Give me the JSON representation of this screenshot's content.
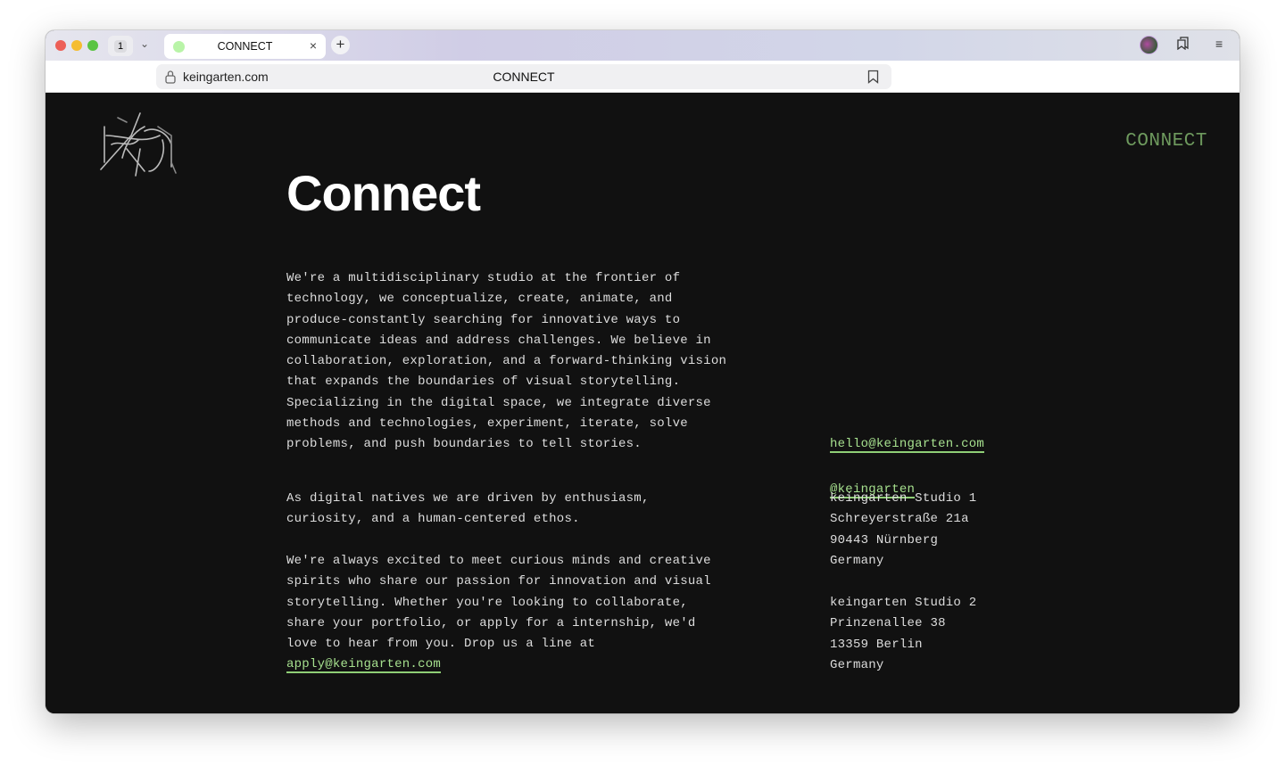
{
  "browser": {
    "tab_count": "1",
    "tab_title": "CONNECT",
    "host": "keingarten.com",
    "page_title": "CONNECT"
  },
  "site": {
    "logo_text": "keingarten",
    "nav_label": "CONNECT",
    "heading": "Connect",
    "intro": "We're a multidisciplinary studio at the frontier of\ntechnology, we conceptualize, create, animate, and\nproduce-constantly searching for innovative ways to\ncommunicate ideas and address challenges. We believe in\ncollaboration, exploration, and a forward-thinking vision\nthat expands the boundaries of visual storytelling.\nSpecializing in the digital space, we integrate diverse\nmethods and technologies, experiment, iterate, solve\nproblems, and push boundaries to tell stories.",
    "natives": "As digital natives we are driven by enthusiasm,\ncuriosity, and a human-centered ethos.",
    "invite": "We're always excited to meet curious minds and creative\nspirits who share our passion for innovation and visual\nstorytelling. Whether you're looking to collaborate,\nshare your portfolio, or apply for a internship, we'd\nlove to hear from you. Drop us a line at",
    "apply_email": "apply@keingarten.com",
    "contact_email": "hello@keingarten.com",
    "instagram": "@keingarten",
    "studio1": "keingarten Studio 1\nSchreyerstraße 21a\n90443 Nürnberg\nGermany",
    "studio2": "keingarten Studio 2\nPrinzenallee 38\n13359 Berlin\nGermany"
  },
  "colors": {
    "accent": "#a6e08e",
    "nav": "#6e9a5e",
    "background": "#111111"
  }
}
